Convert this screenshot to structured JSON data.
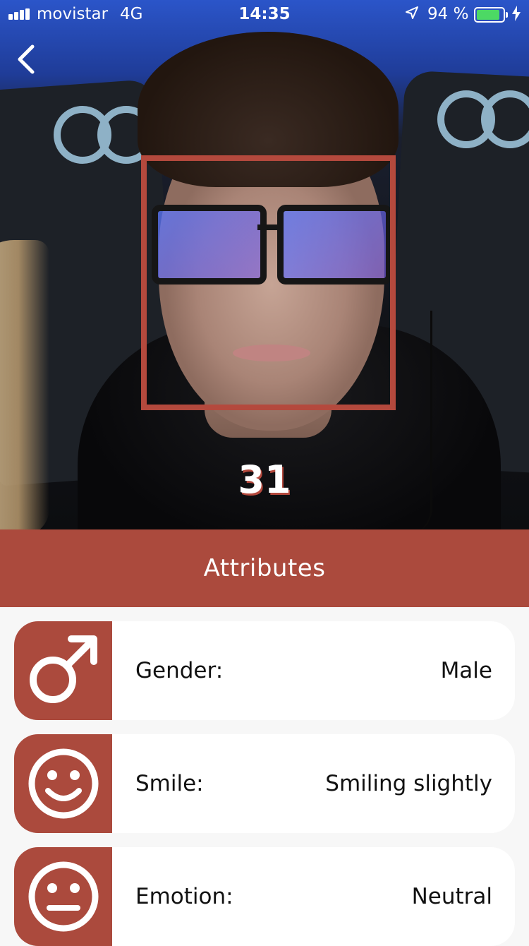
{
  "status_bar": {
    "carrier": "movistar",
    "network": "4G",
    "time": "14:35",
    "battery": "94 %",
    "battery_level": 0.94
  },
  "photo": {
    "age": "31"
  },
  "attributes": {
    "title": "Attributes",
    "items": [
      {
        "icon": "male-symbol-icon",
        "label": "Gender:",
        "value": "Male"
      },
      {
        "icon": "smiling-face-icon",
        "label": "Smile:",
        "value": "Smiling slightly"
      },
      {
        "icon": "neutral-face-icon",
        "label": "Emotion:",
        "value": "Neutral"
      }
    ]
  },
  "colors": {
    "accent": "#ab4a3d",
    "face_box": "#b4493d",
    "battery": "#4cd964"
  }
}
